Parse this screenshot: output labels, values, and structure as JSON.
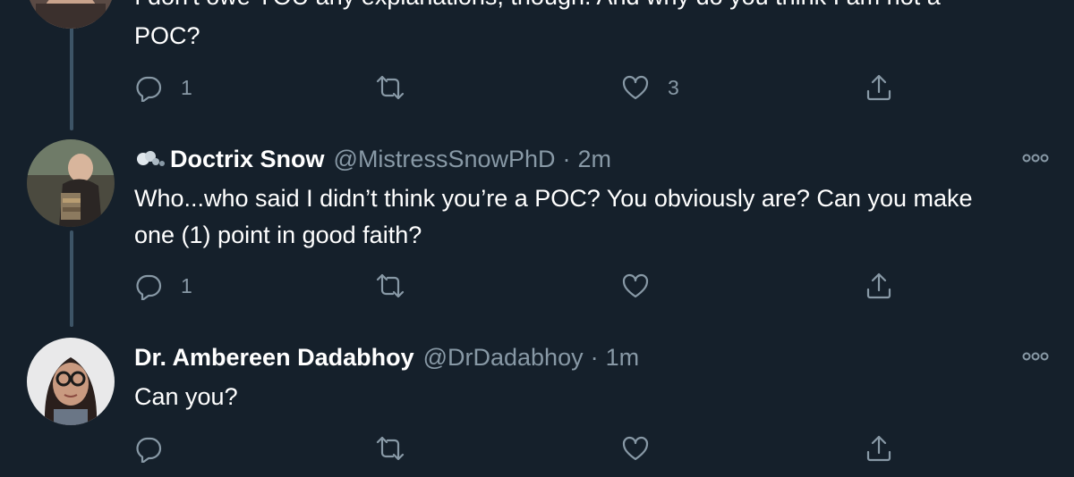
{
  "tweets": [
    {
      "text_partial": "I don't owe YOU any explanations, though. And why do you think I am not a",
      "text_tail": "POC?",
      "actions": {
        "reply_count": "1",
        "retweet_count": "",
        "like_count": "3"
      }
    },
    {
      "name": "Doctrix Snow",
      "handle": "@MistressSnowPhD",
      "separator": "·",
      "time": "2m",
      "text_line1": "Who...who said I didn’t think you’re a POC? You obviously are? Can you make",
      "text_line2": "one (1) point in good faith?",
      "actions": {
        "reply_count": "1",
        "retweet_count": "",
        "like_count": ""
      }
    },
    {
      "name": "Dr. Ambereen Dadabhoy",
      "handle": "@DrDadabhoy",
      "separator": "·",
      "time": "1m",
      "text": "Can you?",
      "actions": {
        "reply_count": "",
        "retweet_count": "",
        "like_count": ""
      }
    }
  ],
  "theme": {
    "background": "#15202b",
    "muted": "#8899a6",
    "thread_line": "#3d5466",
    "text": "#ffffff"
  },
  "icons": [
    "reply-icon",
    "retweet-icon",
    "like-icon",
    "share-icon",
    "more-options-icon"
  ]
}
